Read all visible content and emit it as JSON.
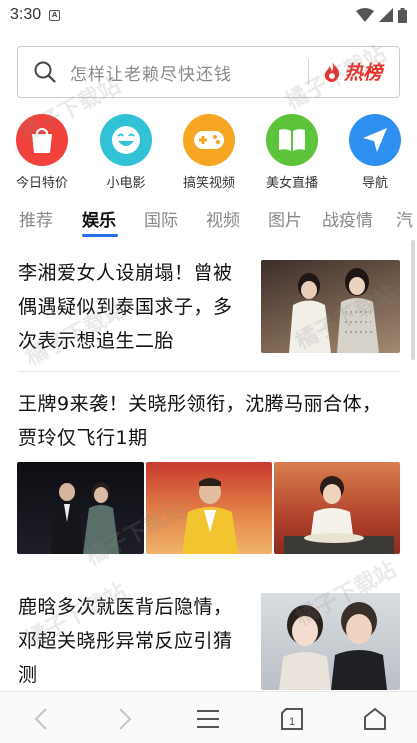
{
  "status_bar": {
    "time": "3:30",
    "sim_label": "A"
  },
  "search": {
    "placeholder": "怎样让老赖尽快还钱",
    "hot_label": "热榜"
  },
  "quick_entries": [
    {
      "label": "今日特价",
      "icon": "shopping-bag-icon",
      "color": "#f0413b"
    },
    {
      "label": "小电影",
      "icon": "smiley-face-icon",
      "color": "#32c2d6"
    },
    {
      "label": "搞笑视频",
      "icon": "gamepad-icon",
      "color": "#f6a623"
    },
    {
      "label": "美女直播",
      "icon": "book-icon",
      "color": "#5cc43a"
    },
    {
      "label": "导航",
      "icon": "navigation-arrow-icon",
      "color": "#2f90f0"
    }
  ],
  "tabs": [
    "推荐",
    "娱乐",
    "国际",
    "视频",
    "图片",
    "战疫情",
    "汽"
  ],
  "active_tab": "娱乐",
  "articles": [
    {
      "title_lines": [
        "李湘爱女人设崩塌！曾被",
        "偶遇疑似到泰国求子，多",
        "次表示想追生二胎"
      ]
    },
    {
      "title_lines": [
        "王牌9来袭！关晓彤领衔，沈腾马丽合体，",
        "贾玲仅飞行1期"
      ]
    },
    {
      "title_lines": [
        "鹿晗多次就医背后隐情，",
        "邓超关晓彤异常反应引猜",
        "测"
      ]
    }
  ],
  "watermark_text": "橘子下载站"
}
